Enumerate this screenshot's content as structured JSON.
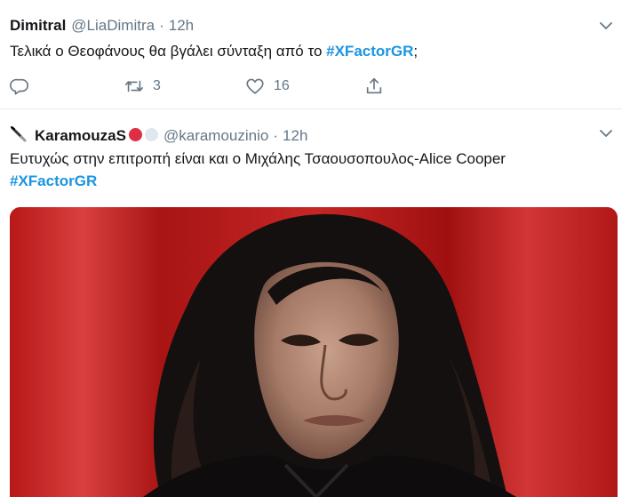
{
  "tweets": [
    {
      "name": "Dimitral",
      "handle": "@LiaDimitra",
      "separator": "·",
      "time": "12h",
      "text_before": "Τελικά ο Θεοφάνους θα βγάλει σύνταξη από το ",
      "hashtag": "#XFactorGR",
      "text_after": ";",
      "retweets": "3",
      "likes": "16"
    },
    {
      "name": "KaramouzaS",
      "handle": "@karamouzinio",
      "separator": "·",
      "time": "12h",
      "line1": "Ευτυχώς στην επιτροπή είναι και ο Μιχάλης  Τσαουσοπουλος-Alice Cooper",
      "hashtag": "#XFactorGR"
    }
  ],
  "icons": {
    "reply": "reply-icon",
    "retweet": "retweet-icon",
    "like": "heart-icon",
    "share": "share-icon",
    "caret": "chevron-down-icon"
  },
  "colors": {
    "hashtag": "#1b95e0",
    "secondary_text": "#657786",
    "photo_background": "#c61f1f"
  }
}
